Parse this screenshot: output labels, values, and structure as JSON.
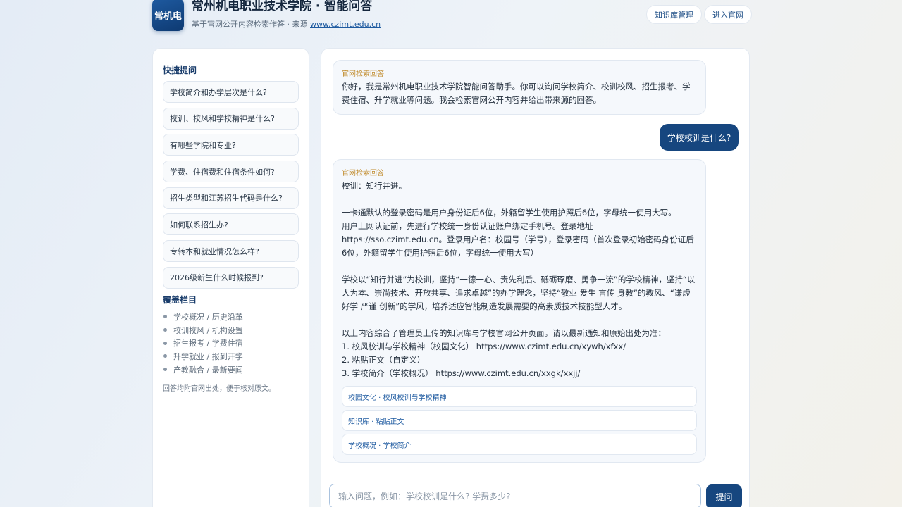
{
  "header": {
    "logo_text": "常机电",
    "title": "常州机电职业技术学院 · 智能问答",
    "subtitle_prefix": "基于官网公开内容检索作答 · 来源 ",
    "subtitle_link": "www.czimt.edu.cn",
    "kb_button": "知识库管理",
    "site_button": "进入官网"
  },
  "sidebar": {
    "quick_title": "快捷提问",
    "questions": [
      "学校简介和办学层次是什么?",
      "校训、校风和学校精神是什么?",
      "有哪些学院和专业?",
      "学费、住宿费和住宿条件如何?",
      "招生类型和江苏招生代码是什么?",
      "如何联系招生办?",
      "专转本和就业情况怎么样?",
      "2026级新生什么时候报到?"
    ],
    "cover_title": "覆盖栏目",
    "cover_items": [
      "学校概况 / 历史沿革",
      "校训校风 / 机构设置",
      "招生报考 / 学费住宿",
      "升学就业 / 报到开学",
      "产教融合 / 最新要闻"
    ],
    "note": "回答均附官网出处，便于核对原文。"
  },
  "chat": {
    "greeting_tag": "官网检索回答",
    "greeting_text": "你好，我是常州机电职业技术学院智能问答助手。你可以询问学校简介、校训校风、招生报考、学费住宿、升学就业等问题。我会检索官网公开内容并给出带来源的回答。",
    "user_message": "学校校训是什么?",
    "answer_tag": "官网检索回答",
    "answer_text": "校训：知行并进。\n\n一卡通默认的登录密码是用户身份证后6位，外籍留学生使用护照后6位，字母统一使用大写。\n用户上网认证前，先进行学校统一身份认证账户绑定手机号。登录地址https://sso.czimt.edu.cn。登录用户名：校园号（学号），登录密码（首次登录初始密码身份证后6位，外籍留学生使用护照后6位，字母统一使用大写）\n\n学校以“知行并进”为校训，坚持“一德一心、责先利后、砥砺琢磨、勇争一流”的学校精神，坚持“以人为本、崇尚技术、开放共享、追求卓越”的办学理念，坚持“敬业 爱生 言传 身教”的教风、“谦虚 好学 严谨 创新”的学风，培养适应智能制造发展需要的高素质技术技能型人才。\n\n以上内容综合了管理员上传的知识库与学校官网公开页面。请以最新通知和原始出处为准：\n1. 校风校训与学校精神（校园文化） https://www.czimt.edu.cn/xywh/xfxx/\n2. 粘贴正文（自定义）\n3. 学校简介（学校概况） https://www.czimt.edu.cn/xxgk/xxjj/",
    "sources": [
      "校园文化 · 校风校训与学校精神",
      "知识库 · 粘贴正文",
      "学校概况 · 学校简介"
    ],
    "input_placeholder": "输入问题，例如：学校校训是什么? 学费多少?",
    "input_value": "",
    "send_label": "提问"
  }
}
